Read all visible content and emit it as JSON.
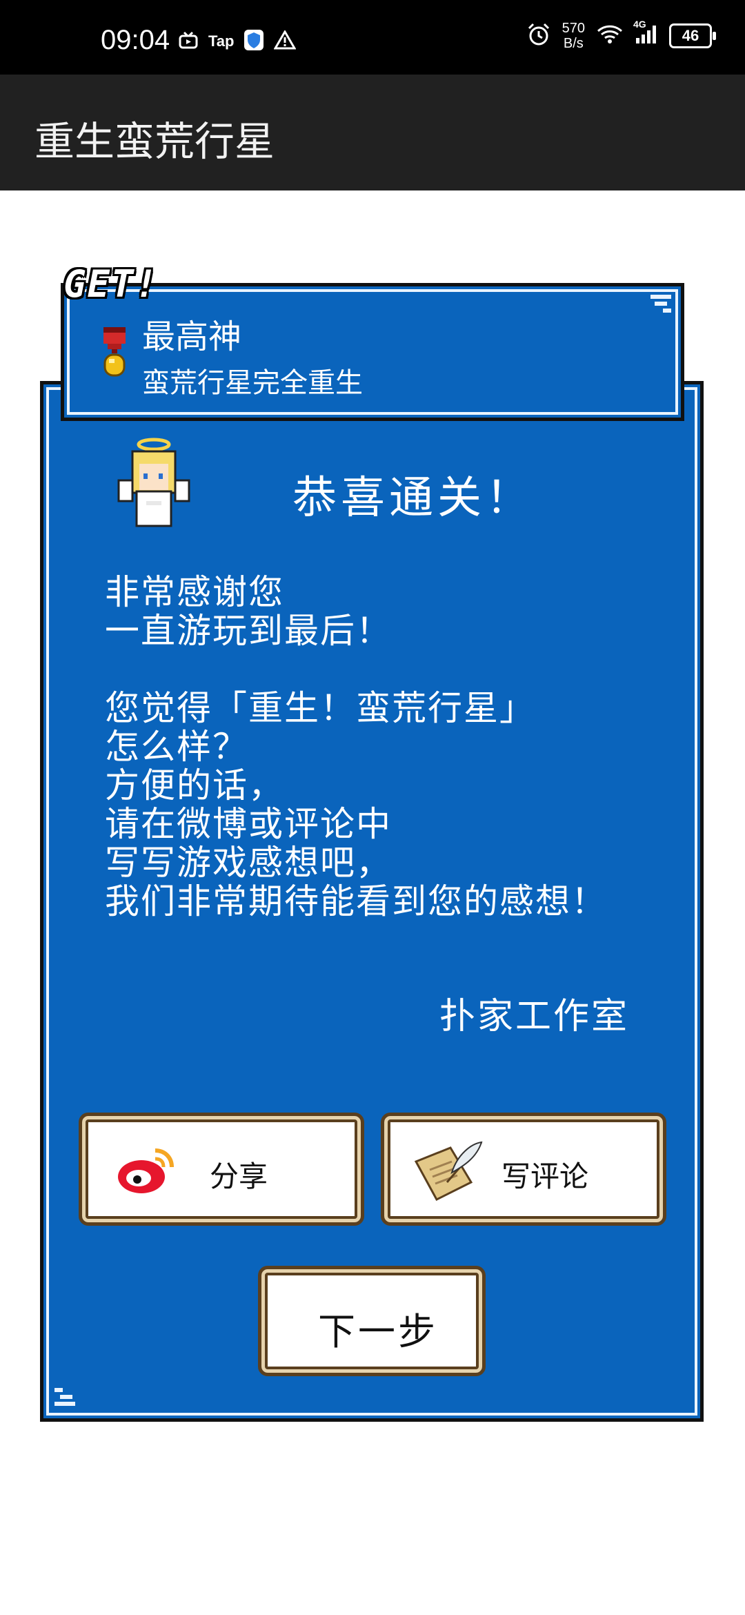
{
  "status_bar": {
    "time": "09:04",
    "tap_label": "Tap",
    "speed_value": "570",
    "speed_unit": "B/s",
    "network": "4G",
    "battery": "46"
  },
  "app_bar": {
    "title": "重生蛮荒行星"
  },
  "achievement": {
    "badge": "GET!",
    "title": "最高神",
    "subtitle": "蛮荒行星完全重生"
  },
  "dialog": {
    "heading": "恭喜通关！",
    "message": "非常感谢您\n一直游玩到最后！\n\n您觉得「重生！蛮荒行星」\n怎么样？\n方便的话，\n请在微博或评论中\n写写游戏感想吧，\n我们非常期待能看到您的感想！",
    "signature": "扑家工作室"
  },
  "buttons": {
    "share": "分享",
    "review": "写评论",
    "next": "下一步"
  },
  "colors": {
    "panel_blue": "#0a64bc",
    "button_border": "#5a3f1e",
    "button_trim": "#e6d3ad"
  }
}
